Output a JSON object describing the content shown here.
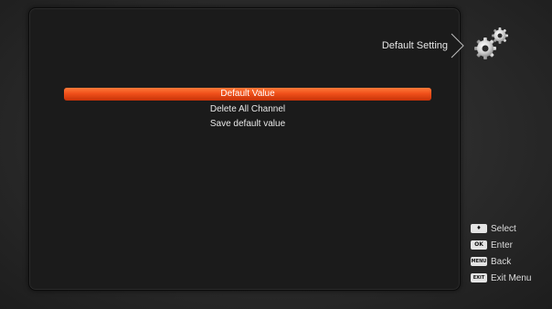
{
  "header": {
    "title": "Default Setting",
    "icon": "gear-icon"
  },
  "menu": {
    "items": [
      {
        "label": "Default Value",
        "selected": true
      },
      {
        "label": "Delete All Channel",
        "selected": false
      },
      {
        "label": "Save default value",
        "selected": false
      }
    ]
  },
  "legend": [
    {
      "key": "♦",
      "label": "Select"
    },
    {
      "key": "OK",
      "label": "Enter"
    },
    {
      "key": "MENU",
      "label": "Back"
    },
    {
      "key": "EXIT",
      "label": "Exit Menu"
    }
  ],
  "colors": {
    "highlight": "#f0501a",
    "background": "#2a2a2a",
    "panel": "#1b1b1b"
  }
}
